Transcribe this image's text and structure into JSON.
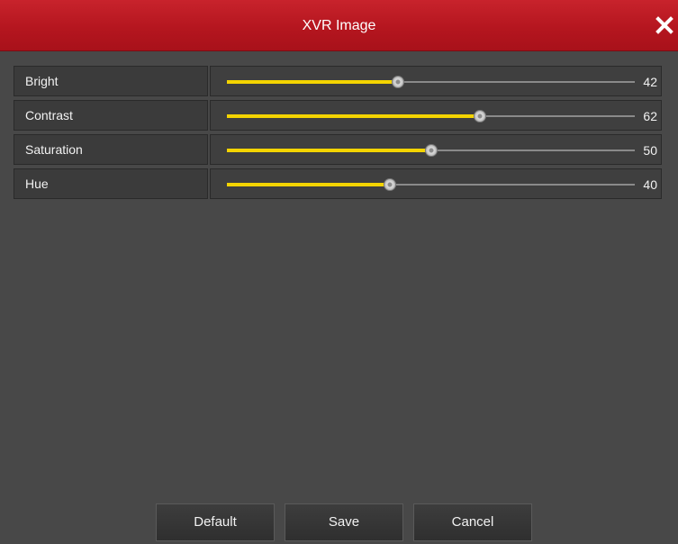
{
  "window": {
    "title": "XVR Image",
    "title_bar_color": "#b5161f",
    "close_icon": "close-icon"
  },
  "settings": [
    {
      "label": "Bright",
      "value": "42",
      "level": 42
    },
    {
      "label": "Contrast",
      "value": "62",
      "level": 62
    },
    {
      "label": "Saturation",
      "value": "50",
      "level": 50
    },
    {
      "label": "Hue",
      "value": "40",
      "level": 40
    }
  ],
  "slider_range": {
    "min": 0,
    "max": 100
  },
  "colors": {
    "slider_fill": "#f4d400",
    "track": "#8a8a8a"
  },
  "buttons": {
    "default_label": "Default",
    "save_label": "Save",
    "cancel_label": "Cancel"
  }
}
